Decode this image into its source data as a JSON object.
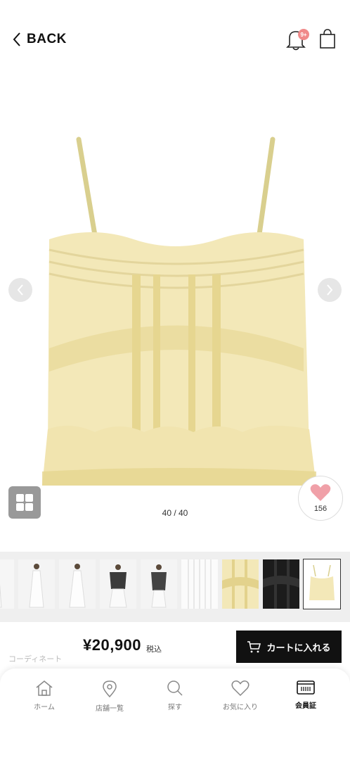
{
  "header": {
    "back_label": "BACK",
    "notification_badge": "9+"
  },
  "gallery": {
    "counter": "40 / 40",
    "favorite_count": "156"
  },
  "thumbnails": [
    {
      "name": "model-white-dress-1"
    },
    {
      "name": "model-white-dress-2"
    },
    {
      "name": "model-white-dress-3"
    },
    {
      "name": "model-black-jacket-1"
    },
    {
      "name": "model-black-jacket-2"
    },
    {
      "name": "white-pleated-detail"
    },
    {
      "name": "yellow-lace-detail"
    },
    {
      "name": "black-lace-detail"
    },
    {
      "name": "camisole-product"
    }
  ],
  "purchase": {
    "coordinate_label": "コーディネート",
    "price": "¥20,900",
    "tax_label": "税込",
    "cart_button": "カートに入れる"
  },
  "nav": {
    "home": "ホーム",
    "stores": "店舗一覧",
    "search": "探す",
    "favorites": "お気に入り",
    "member_card": "会員証"
  },
  "colors": {
    "favorite_heart": "#f0a0a8",
    "badge": "#f08a8a",
    "product_fabric": "#f3e8b8"
  }
}
